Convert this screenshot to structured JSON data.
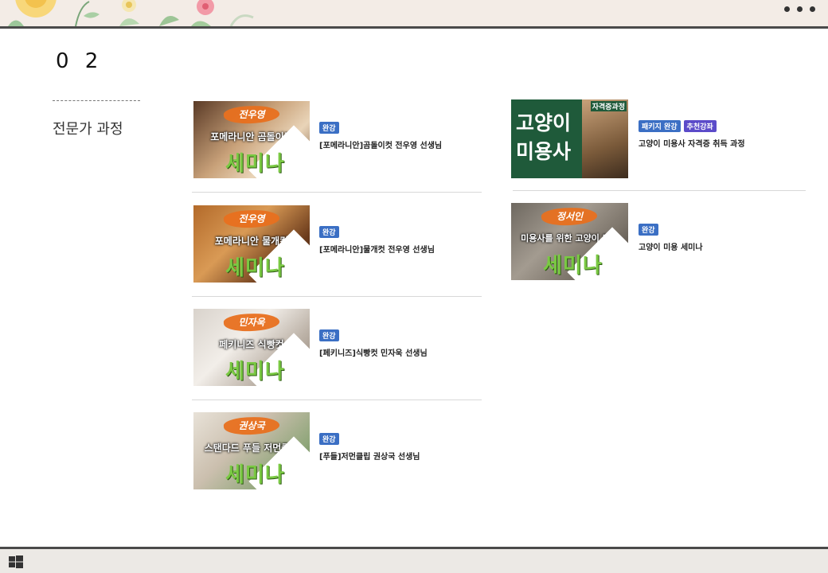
{
  "section": {
    "number": "0 2",
    "title": "전문가 과정"
  },
  "courses_left": [
    {
      "thumb_name": "전우영",
      "thumb_course": "포메라니안 곰돌이컷",
      "thumb_seminar": "세미나",
      "badges": [
        "완강"
      ],
      "title": "[포메라니안]곰돌이컷 전우영 선생님"
    },
    {
      "thumb_name": "전우영",
      "thumb_course": "포메라니안 물개컷",
      "thumb_seminar": "세미나",
      "badges": [
        "완강"
      ],
      "title": "[포메라니안]물개컷 전우영 선생님"
    },
    {
      "thumb_name": "민자욱",
      "thumb_course": "페키니즈 식빵컷",
      "thumb_seminar": "세미나",
      "badges": [
        "완강"
      ],
      "title": "[페키니즈]식빵컷 민자욱 선생님"
    },
    {
      "thumb_name": "권상국",
      "thumb_course": "스탠다드 푸들 저먼클립",
      "thumb_seminar": "세미나",
      "badges": [
        "완강"
      ],
      "title": "[푸들]저먼클립 권상국 선생님"
    }
  ],
  "courses_right": [
    {
      "thumb_corner": "자격증과정",
      "thumb_big_line1": "고양이",
      "thumb_big_line2": "미용사",
      "badges": [
        "패키지 완강",
        "추천강좌"
      ],
      "title": "고양이 미용사 자격증 취득 과정"
    },
    {
      "thumb_name": "정서인",
      "thumb_course": "미용사를 위한 고양이 미용",
      "thumb_seminar": "세미나",
      "badges": [
        "완강"
      ],
      "title": "고양이 미용 세미나"
    }
  ],
  "colors": {
    "badge_blue": "#3b6fc4",
    "badge_purple": "#5b4bc9",
    "seminar_green": "#7ac943",
    "brush_orange": "#e8701f"
  },
  "icons": [
    "more-dots-icon",
    "windows-start-icon"
  ]
}
